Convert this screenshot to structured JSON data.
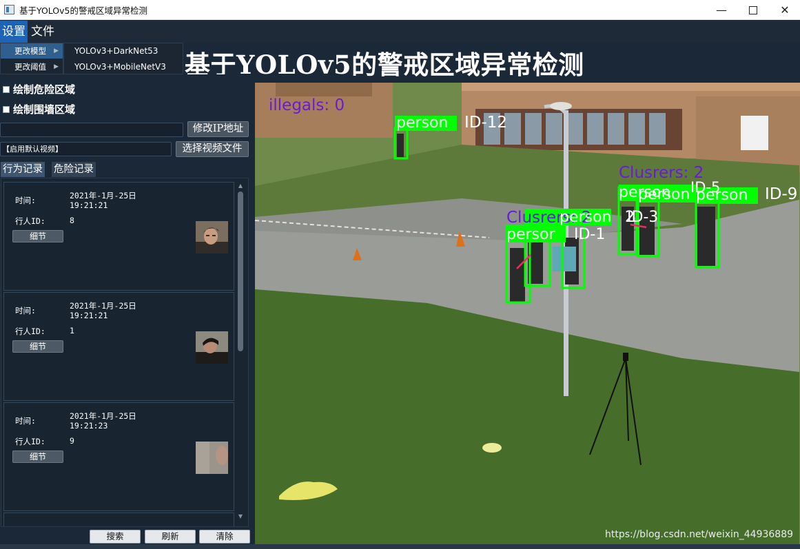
{
  "window": {
    "title": "基于YOLOv5的警戒区域异常检测",
    "min_glyph": "—",
    "close_glyph": "✕"
  },
  "menubar": {
    "settings": "设置",
    "file": "文件"
  },
  "dropdown": {
    "items": [
      {
        "label": "更改模型"
      },
      {
        "label": "更改阈值"
      }
    ],
    "submenu": [
      "YOLOv3+DarkNet53",
      "YOLOv3+MobileNetV3"
    ]
  },
  "header": {
    "title": "基于YOLOv5的警戒区域异常检测"
  },
  "options": {
    "draw_danger": "绘制危险区域",
    "draw_fence": "绘制围墙区域",
    "ip_value": "",
    "ip_button": "修改IP地址",
    "video_value": "【启用默认视频】",
    "video_button": "选择视频文件"
  },
  "tabs": [
    "行为记录",
    "危险记录"
  ],
  "records": [
    {
      "time_label": "时间:",
      "date": "2021年-1月-25日",
      "time": "19:21:21",
      "id_label": "行人ID:",
      "id": "8",
      "detail": "细节"
    },
    {
      "time_label": "时间:",
      "date": "2021年-1月-25日",
      "time": "19:21:21",
      "id_label": "行人ID:",
      "id": "1",
      "detail": "细节"
    },
    {
      "time_label": "时间:",
      "date": "2021年-1月-25日",
      "time": "19:21:23",
      "id_label": "行人ID:",
      "id": "9",
      "detail": "细节"
    }
  ],
  "bottom_buttons": [
    "搜索",
    "刷新",
    "清除"
  ],
  "video": {
    "overlay": {
      "illegals": "illegals: 0",
      "clusters_1": "Clusrers: 2",
      "clusters_2": "Clusrers: 2",
      "p1_label": "person",
      "p1_id": "ID-12",
      "p2_label": "person",
      "p3_label": "person",
      "p4_label": "person",
      "p4_id": "ID-9",
      "p5_label": "persor",
      "p5_id": "ID-1",
      "p6_label": "person",
      "p6_id": "ID-3",
      "p7_label": "2",
      "p8_id": "ID-5"
    },
    "colors": {
      "box": "#00ff00",
      "clusters": "#6a1bd6",
      "id": "#ffffff"
    }
  },
  "watermark": "https://blog.csdn.net/weixin_44936889"
}
